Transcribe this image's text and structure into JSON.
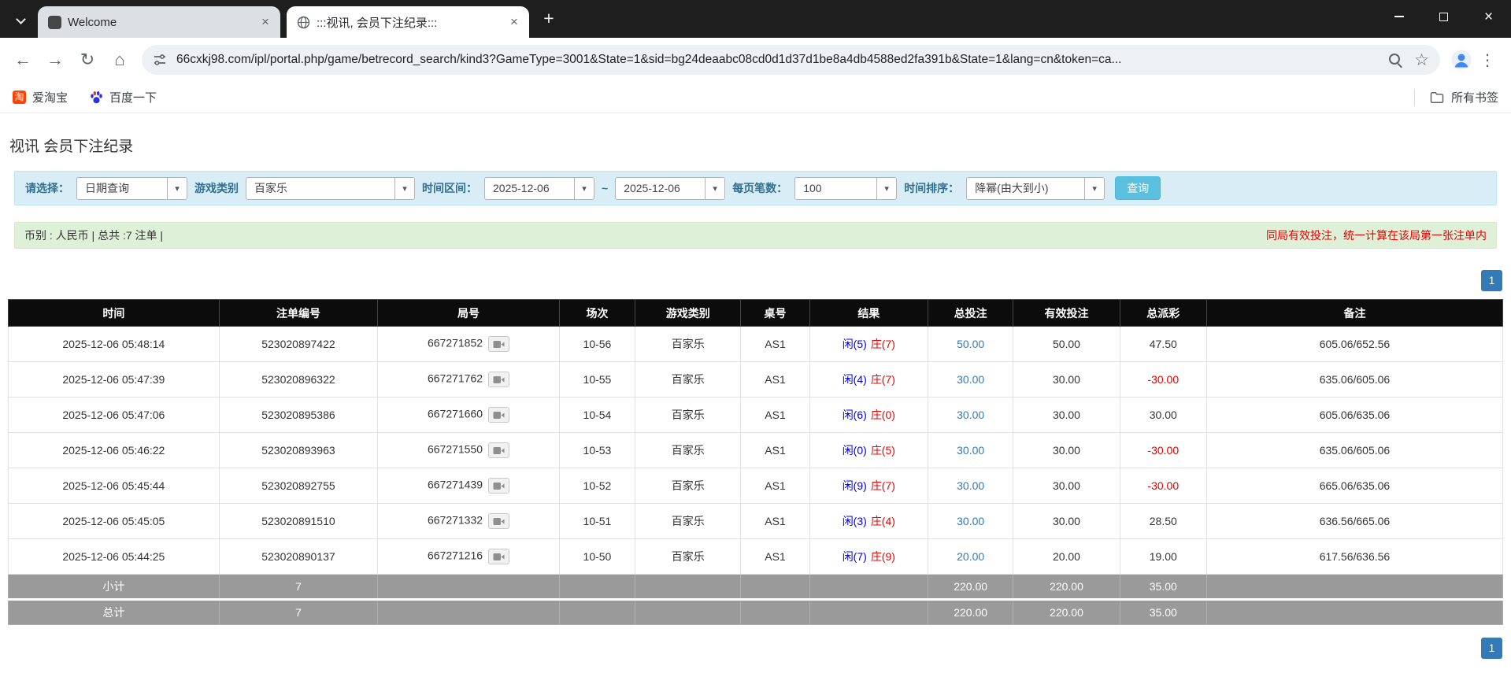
{
  "icons": {
    "close": "×",
    "plus": "+",
    "back": "←",
    "forward": "→",
    "reload": "↻",
    "home": "⌂",
    "star": "☆",
    "menu": "⋮",
    "caret": "▾"
  },
  "colors": {
    "accent_blue": "#337ab7",
    "result_player_blue": "#0000ee",
    "result_banker_red": "#ee0000",
    "negative_red": "#e60000",
    "search_button": "#5bc0de",
    "filter_bg": "#d9edf7",
    "summary_bg": "#dff0d8",
    "table_header_bg": "#0c0c0c",
    "table_footer_bg": "#9a9a9a"
  },
  "browser": {
    "tabs": [
      {
        "title": "Welcome"
      },
      {
        "title": ":::视讯, 会员下注纪录:::"
      }
    ],
    "url": "66cxkj98.com/ipl/portal.php/game/betrecord_search/kind3?GameType=3001&State=1&sid=bg24deaabc08cd0d1d37d1be8a4db4588ed2fa391b&State=1&lang=cn&token=ca...",
    "bookmarks": [
      {
        "label": "爱淘宝"
      },
      {
        "label": "百度一下"
      }
    ],
    "all_bookmarks": "所有书签"
  },
  "page": {
    "title": "视讯 会员下注纪录",
    "filters": {
      "select_label": "请选择：",
      "select_value": "日期查询",
      "game_type_label": "游戏类别",
      "game_type_value": "百家乐",
      "date_range_label": "时间区间：",
      "date_from": "2025-12-06",
      "date_to": "2025-12-06",
      "tilde": "~",
      "page_size_label": "每页笔数：",
      "page_size_value": "100",
      "sort_label": "时间排序：",
      "sort_value": "降幂(由大到小)",
      "search_button": "查询"
    },
    "summary": {
      "left": "币别 : 人民币 | 总共 :7 注单 |",
      "right": "同局有效投注，统一计算在该局第一张注单内"
    },
    "pagination": "1",
    "table": {
      "headers": [
        "时间",
        "注单编号",
        "局号",
        "场次",
        "游戏类别",
        "桌号",
        "结果",
        "总投注",
        "有效投注",
        "总派彩",
        "备注"
      ],
      "rows": [
        {
          "time": "2025-12-06 05:48:14",
          "bet_id": "523020897422",
          "round": "667271852",
          "session": "10-56",
          "game": "百家乐",
          "table_no": "AS1",
          "result_player": "闲(5)",
          "result_banker": "庄(7)",
          "total_bet": "50.00",
          "valid_bet": "50.00",
          "payout": "47.50",
          "payout_neg": false,
          "note": "605.06/652.56"
        },
        {
          "time": "2025-12-06 05:47:39",
          "bet_id": "523020896322",
          "round": "667271762",
          "session": "10-55",
          "game": "百家乐",
          "table_no": "AS1",
          "result_player": "闲(4)",
          "result_banker": "庄(7)",
          "total_bet": "30.00",
          "valid_bet": "30.00",
          "payout": "-30.00",
          "payout_neg": true,
          "note": "635.06/605.06"
        },
        {
          "time": "2025-12-06 05:47:06",
          "bet_id": "523020895386",
          "round": "667271660",
          "session": "10-54",
          "game": "百家乐",
          "table_no": "AS1",
          "result_player": "闲(6)",
          "result_banker": "庄(0)",
          "total_bet": "30.00",
          "valid_bet": "30.00",
          "payout": "30.00",
          "payout_neg": false,
          "note": "605.06/635.06"
        },
        {
          "time": "2025-12-06 05:46:22",
          "bet_id": "523020893963",
          "round": "667271550",
          "session": "10-53",
          "game": "百家乐",
          "table_no": "AS1",
          "result_player": "闲(0)",
          "result_banker": "庄(5)",
          "total_bet": "30.00",
          "valid_bet": "30.00",
          "payout": "-30.00",
          "payout_neg": true,
          "note": "635.06/605.06"
        },
        {
          "time": "2025-12-06 05:45:44",
          "bet_id": "523020892755",
          "round": "667271439",
          "session": "10-52",
          "game": "百家乐",
          "table_no": "AS1",
          "result_player": "闲(9)",
          "result_banker": "庄(7)",
          "total_bet": "30.00",
          "valid_bet": "30.00",
          "payout": "-30.00",
          "payout_neg": true,
          "note": "665.06/635.06"
        },
        {
          "time": "2025-12-06 05:45:05",
          "bet_id": "523020891510",
          "round": "667271332",
          "session": "10-51",
          "game": "百家乐",
          "table_no": "AS1",
          "result_player": "闲(3)",
          "result_banker": "庄(4)",
          "total_bet": "30.00",
          "valid_bet": "30.00",
          "payout": "28.50",
          "payout_neg": false,
          "note": "636.56/665.06"
        },
        {
          "time": "2025-12-06 05:44:25",
          "bet_id": "523020890137",
          "round": "667271216",
          "session": "10-50",
          "game": "百家乐",
          "table_no": "AS1",
          "result_player": "闲(7)",
          "result_banker": "庄(9)",
          "total_bet": "20.00",
          "valid_bet": "20.00",
          "payout": "19.00",
          "payout_neg": false,
          "note": "617.56/636.56"
        }
      ],
      "subtotal": {
        "label": "小计",
        "count": "7",
        "total_bet": "220.00",
        "valid_bet": "220.00",
        "payout": "35.00"
      },
      "total": {
        "label": "总计",
        "count": "7",
        "total_bet": "220.00",
        "valid_bet": "220.00",
        "payout": "35.00"
      }
    }
  }
}
